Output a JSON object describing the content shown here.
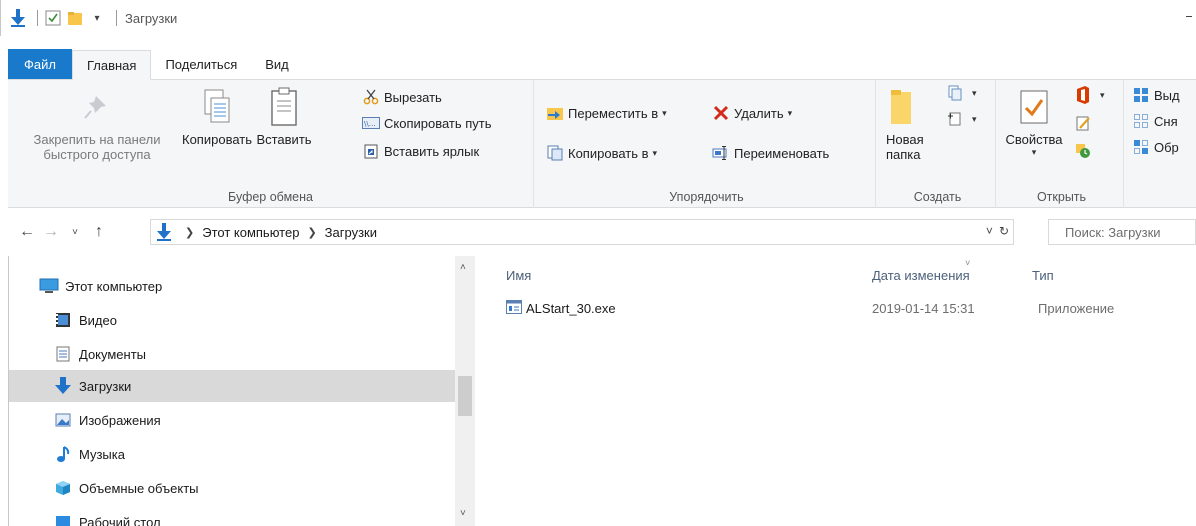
{
  "window": {
    "title": "Загрузки"
  },
  "ribbon_tabs": [
    "Файл",
    "Главная",
    "Поделиться",
    "Вид"
  ],
  "ribbon": {
    "clipboard": {
      "label": "Буфер обмена",
      "pin_line1": "Закрепить на панели",
      "pin_line2": "быстрого доступа",
      "copy": "Копировать",
      "paste": "Вставить",
      "cut": "Вырезать",
      "copy_path": "Скопировать путь",
      "paste_shortcut": "Вставить ярлык"
    },
    "organize": {
      "label": "Упорядочить",
      "move_to": "Переместить в",
      "copy_to": "Копировать в",
      "delete": "Удалить",
      "rename": "Переименовать"
    },
    "create": {
      "label": "Создать",
      "new_folder_line1": "Новая",
      "new_folder_line2": "папка"
    },
    "open": {
      "label": "Открыть",
      "properties": "Свойства"
    },
    "select": {
      "select_all": "Выд",
      "select_none": "Сня",
      "invert": "Обр"
    }
  },
  "address_bar": {
    "crumbs": [
      "Этот компьютер",
      "Загрузки"
    ],
    "search_placeholder": "Поиск: Загрузки"
  },
  "nav_pane": {
    "items": [
      {
        "label": "Этот компьютер",
        "icon": "computer-icon"
      },
      {
        "label": "Видео",
        "icon": "video-icon"
      },
      {
        "label": "Документы",
        "icon": "documents-icon"
      },
      {
        "label": "Загрузки",
        "icon": "downloads-icon",
        "selected": true
      },
      {
        "label": "Изображения",
        "icon": "pictures-icon"
      },
      {
        "label": "Музыка",
        "icon": "music-icon"
      },
      {
        "label": "Объемные объекты",
        "icon": "3d-objects-icon"
      },
      {
        "label": "Рабочий стол",
        "icon": "desktop-icon"
      }
    ]
  },
  "file_list": {
    "columns": {
      "name": "Имя",
      "date": "Дата изменения",
      "type": "Тип"
    },
    "files": [
      {
        "name": "ALStart_30.exe",
        "date": "2019-01-14 15:31",
        "type": "Приложение"
      }
    ]
  },
  "colors": {
    "accent": "#1979ca",
    "selected": "#d9d9d9",
    "ribbon_bg": "#f5f6f7"
  }
}
